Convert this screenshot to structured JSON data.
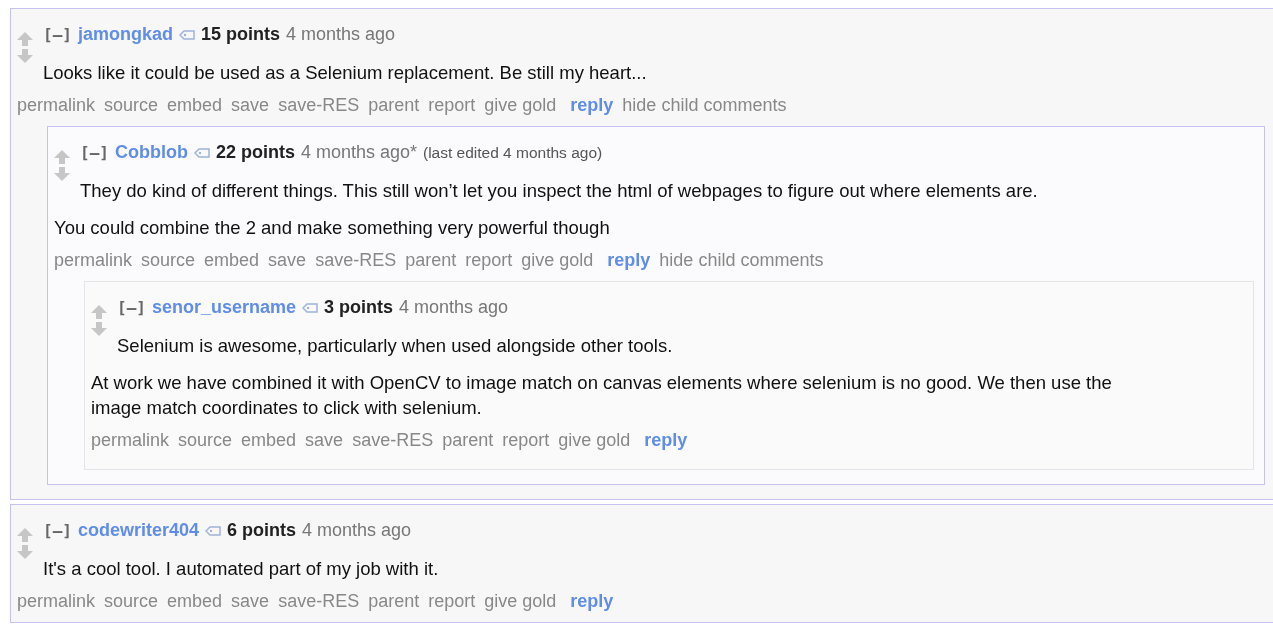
{
  "comments": [
    {
      "toggle": "[–]",
      "author": "jamongkad",
      "points": "15 points",
      "time": "4 months ago",
      "paragraphs": [
        "Looks like it could be used as a Selenium replacement. Be still my heart..."
      ],
      "actions": [
        {
          "label": "permalink",
          "kind": "link"
        },
        {
          "label": "source",
          "kind": "link"
        },
        {
          "label": "embed",
          "kind": "link"
        },
        {
          "label": "save",
          "kind": "link"
        },
        {
          "label": "save-RES",
          "kind": "link"
        },
        {
          "label": "parent",
          "kind": "link"
        },
        {
          "label": "report",
          "kind": "link"
        },
        {
          "label": "give gold",
          "kind": "link"
        },
        {
          "label": "reply",
          "kind": "reply"
        },
        {
          "label": "hide child comments",
          "kind": "link"
        }
      ],
      "children": [
        {
          "toggle": "[–]",
          "author": "Cobblob",
          "points": "22 points",
          "time": "4 months ago*",
          "edited": "(last edited 4 months ago)",
          "paragraphs": [
            "They do kind of different things. This still won’t let you inspect the html of webpages to figure out where elements are.",
            "You could combine the 2 and make something very powerful though"
          ],
          "actions": [
            {
              "label": "permalink",
              "kind": "link"
            },
            {
              "label": "source",
              "kind": "link"
            },
            {
              "label": "embed",
              "kind": "link"
            },
            {
              "label": "save",
              "kind": "link"
            },
            {
              "label": "save-RES",
              "kind": "link"
            },
            {
              "label": "parent",
              "kind": "link"
            },
            {
              "label": "report",
              "kind": "link"
            },
            {
              "label": "give gold",
              "kind": "link"
            },
            {
              "label": "reply",
              "kind": "reply"
            },
            {
              "label": "hide child comments",
              "kind": "link"
            }
          ],
          "children": [
            {
              "toggle": "[–]",
              "author": "senor_username",
              "points": "3 points",
              "time": "4 months ago",
              "paragraphs": [
                "Selenium is awesome, particularly when used alongside other tools.",
                "At work we have combined it with OpenCV to image match on canvas elements where selenium is no good. We then use the image match coordinates to click with selenium."
              ],
              "actions": [
                {
                  "label": "permalink",
                  "kind": "link"
                },
                {
                  "label": "source",
                  "kind": "link"
                },
                {
                  "label": "embed",
                  "kind": "link"
                },
                {
                  "label": "save",
                  "kind": "link"
                },
                {
                  "label": "save-RES",
                  "kind": "link"
                },
                {
                  "label": "parent",
                  "kind": "link"
                },
                {
                  "label": "report",
                  "kind": "link"
                },
                {
                  "label": "give gold",
                  "kind": "link"
                },
                {
                  "label": "reply",
                  "kind": "reply"
                }
              ]
            }
          ]
        }
      ]
    },
    {
      "toggle": "[–]",
      "author": "codewriter404",
      "points": "6 points",
      "time": "4 months ago",
      "paragraphs": [
        "It's a cool tool. I automated part of my job with it."
      ],
      "actions": [
        {
          "label": "permalink",
          "kind": "link"
        },
        {
          "label": "source",
          "kind": "link"
        },
        {
          "label": "embed",
          "kind": "link"
        },
        {
          "label": "save",
          "kind": "link"
        },
        {
          "label": "save-RES",
          "kind": "link"
        },
        {
          "label": "parent",
          "kind": "link"
        },
        {
          "label": "report",
          "kind": "link"
        },
        {
          "label": "give gold",
          "kind": "link"
        },
        {
          "label": "reply",
          "kind": "reply"
        }
      ]
    }
  ]
}
